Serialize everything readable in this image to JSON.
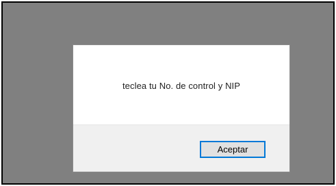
{
  "dialog": {
    "message": "teclea tu No. de control y NIP",
    "ok_label": "Aceptar"
  },
  "colors": {
    "backdrop": "#808080",
    "dialog_body": "#ffffff",
    "dialog_footer": "#f0f0f0",
    "button_focus_border": "#0078d7",
    "button_face": "#e1e1e1"
  }
}
